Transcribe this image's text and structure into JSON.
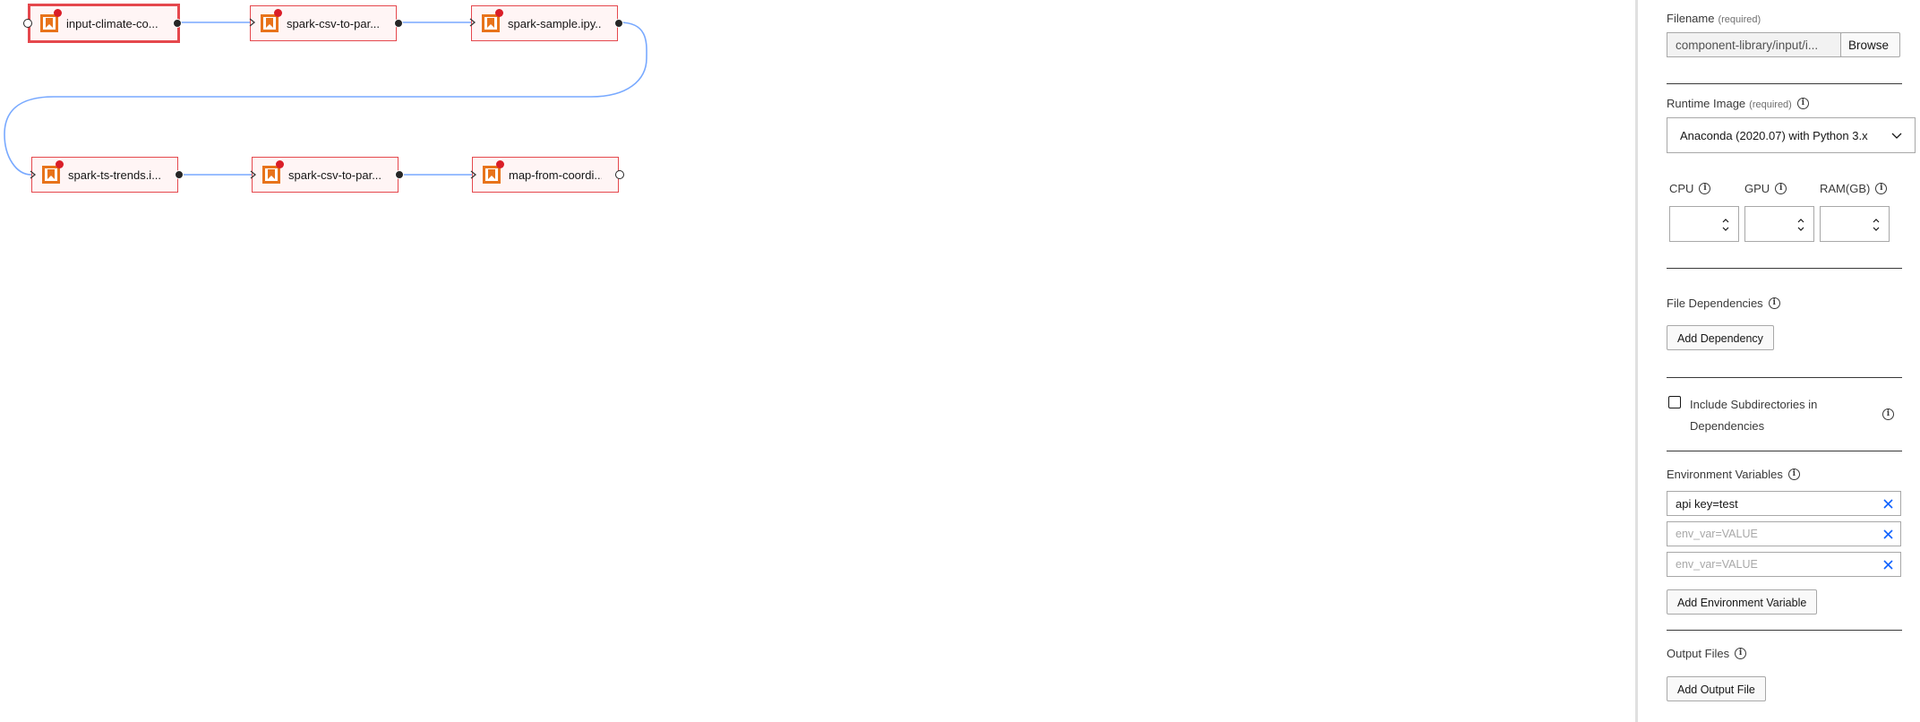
{
  "canvas": {
    "nodes": [
      {
        "id": "n1",
        "label": "input-climate-co...",
        "selected": true
      },
      {
        "id": "n2",
        "label": "spark-csv-to-par...",
        "selected": false
      },
      {
        "id": "n3",
        "label": "spark-sample.ipy...",
        "selected": false
      },
      {
        "id": "n4",
        "label": "spark-ts-trends.i...",
        "selected": false
      },
      {
        "id": "n5",
        "label": "spark-csv-to-par...",
        "selected": false
      },
      {
        "id": "n6",
        "label": "map-from-coordi...",
        "selected": false
      }
    ],
    "icons": {
      "node": "bookmark-notebook-icon",
      "error": "error-dot-icon"
    },
    "colors": {
      "link": "#78a9ff",
      "node_border": "#e5484d",
      "node_bg": "#fff5f5",
      "error": "#da1e28",
      "icon": "#e8731a"
    }
  },
  "panel": {
    "filename": {
      "label": "Filename",
      "required": "(required)",
      "value": "component-library/input/i...",
      "browse": "Browse"
    },
    "runtime": {
      "label": "Runtime Image",
      "required": "(required)",
      "value": "Anaconda (2020.07) with Python 3.x"
    },
    "resources": {
      "cpu": "CPU",
      "gpu": "GPU",
      "ram": "RAM(GB)"
    },
    "file_deps": {
      "label": "File Dependencies",
      "button": "Add Dependency"
    },
    "subdirs": {
      "label_line1": "Include Subdirectories in",
      "label_line2": "Dependencies",
      "checked": false
    },
    "env": {
      "label": "Environment Variables",
      "values": [
        "api key=test",
        "",
        ""
      ],
      "placeholder": "env_var=VALUE",
      "button": "Add Environment Variable"
    },
    "output": {
      "label": "Output Files",
      "button": "Add Output File"
    }
  }
}
